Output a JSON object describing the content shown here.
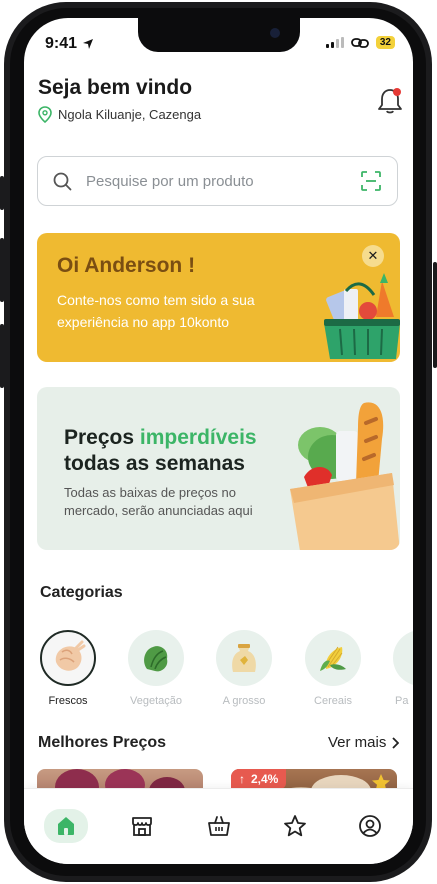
{
  "status_bar": {
    "time": "9:41",
    "battery": "32"
  },
  "header": {
    "greeting": "Seja bem vindo",
    "location": "Ngola Kiluanje, Cazenga"
  },
  "search": {
    "placeholder": "Pesquise por um produto"
  },
  "promo": {
    "title": "Oi Anderson !",
    "text": "Conte-nos como tem sido a sua experiência no app 10konto"
  },
  "deals": {
    "title_part1": "Preços ",
    "title_highlight": "imperdíveis",
    "title_part2": "todas as semanas",
    "subtitle": "Todas as baixas de preços no mercado, serão anunciadas aqui"
  },
  "categories": {
    "title": "Categorias",
    "items": [
      {
        "label": "Frescos",
        "icon": "chicken-icon"
      },
      {
        "label": "Vegetação",
        "icon": "lettuce-icon"
      },
      {
        "label": "A grosso",
        "icon": "sack-icon"
      },
      {
        "label": "Cereais",
        "icon": "corn-icon"
      },
      {
        "label": "Pa",
        "icon": "bread-icon"
      }
    ]
  },
  "best_prices": {
    "title": "Melhores Preços",
    "see_more": "Ver mais",
    "badge": "2,4%"
  },
  "tabbar": {
    "items": [
      "home-icon",
      "store-icon",
      "basket-icon",
      "star-icon",
      "profile-icon"
    ]
  },
  "colors": {
    "accent": "#3cb567",
    "promo_bg": "#efba31",
    "deals_bg": "#e7efe9",
    "badge": "#e75a4f"
  }
}
